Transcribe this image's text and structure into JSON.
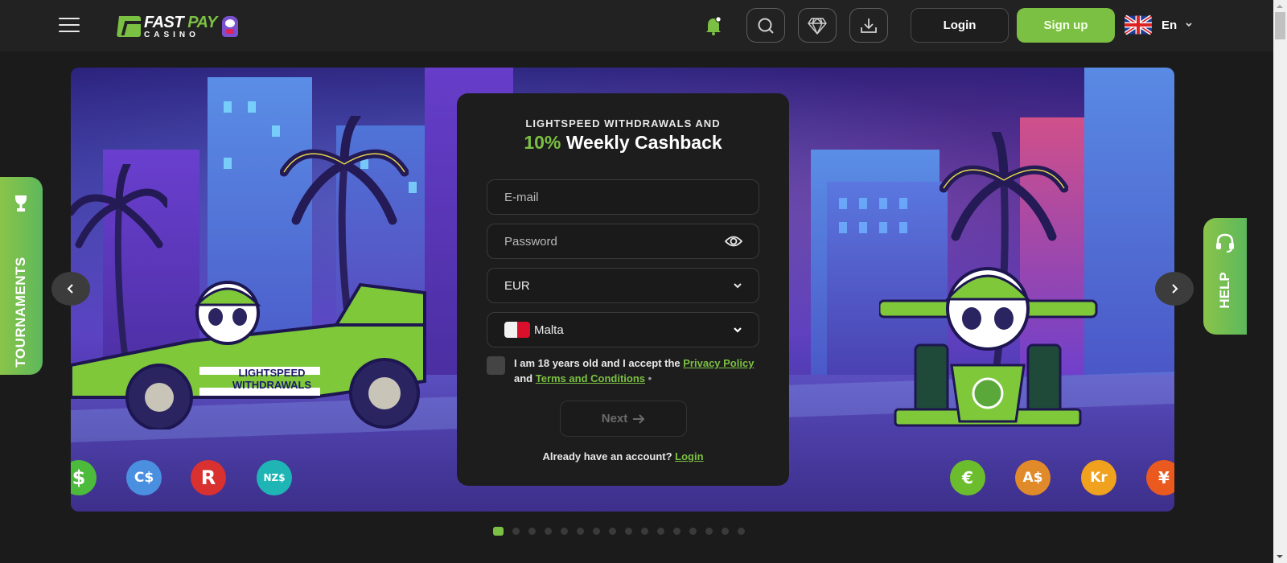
{
  "header": {
    "logo": {
      "word1": "FAST",
      "word2": "PAY",
      "subtitle": "CASINO"
    },
    "menu_icon": "hamburger-icon",
    "notification_icon": "bell-icon",
    "icon_buttons": [
      {
        "name": "search",
        "icon": "search-icon"
      },
      {
        "name": "vip",
        "icon": "diamond-icon"
      },
      {
        "name": "download",
        "icon": "download-icon"
      }
    ],
    "login_label": "Login",
    "signup_label": "Sign up",
    "language": {
      "label": "En",
      "flag": "uk-flag-icon"
    }
  },
  "side_tabs": {
    "left": {
      "label": "TOURNAMENTS",
      "icon": "trophy-icon"
    },
    "right": {
      "label": "HELP",
      "icon": "headset-icon"
    }
  },
  "banner": {
    "car_text_line1": "LIGHTSPEED",
    "car_text_line2": "WITHDRAWALS",
    "currencies_left": [
      {
        "symbol": "$",
        "color": "#4cba3a"
      },
      {
        "symbol": "C$",
        "color": "#4a8fe0"
      },
      {
        "symbol": "R",
        "color": "#d93030"
      },
      {
        "symbol": "NZ$",
        "color": "#1fb5b5"
      }
    ],
    "currencies_right": [
      {
        "symbol": "€",
        "color": "#6cbd2e"
      },
      {
        "symbol": "A$",
        "color": "#e08a2a"
      },
      {
        "symbol": "Kr",
        "color": "#f0a11e"
      },
      {
        "symbol": "¥",
        "color": "#ea5a1e"
      }
    ]
  },
  "form": {
    "eyebrow": "LIGHTSPEED WITHDRAWALS AND",
    "title_accent": "10%",
    "title_rest": "Weekly Cashback",
    "email_placeholder": "E-mail",
    "password_placeholder": "Password",
    "currency_value": "EUR",
    "country_value": "Malta",
    "consent_prefix": "I am 18 years old and I accept the ",
    "privacy_link": "Privacy Policy",
    "consent_and": " and ",
    "terms_link": "Terms and Conditions",
    "required_mark": " •",
    "next_label": "Next",
    "already_text": "Already have an account? ",
    "login_link": "Login"
  },
  "carousel": {
    "total_slides": 16,
    "active_index": 0
  },
  "colors": {
    "accent": "#7bc043",
    "header_bg": "#222222",
    "page_bg": "#1b1b1b",
    "card_bg": "#1d1d1d"
  }
}
